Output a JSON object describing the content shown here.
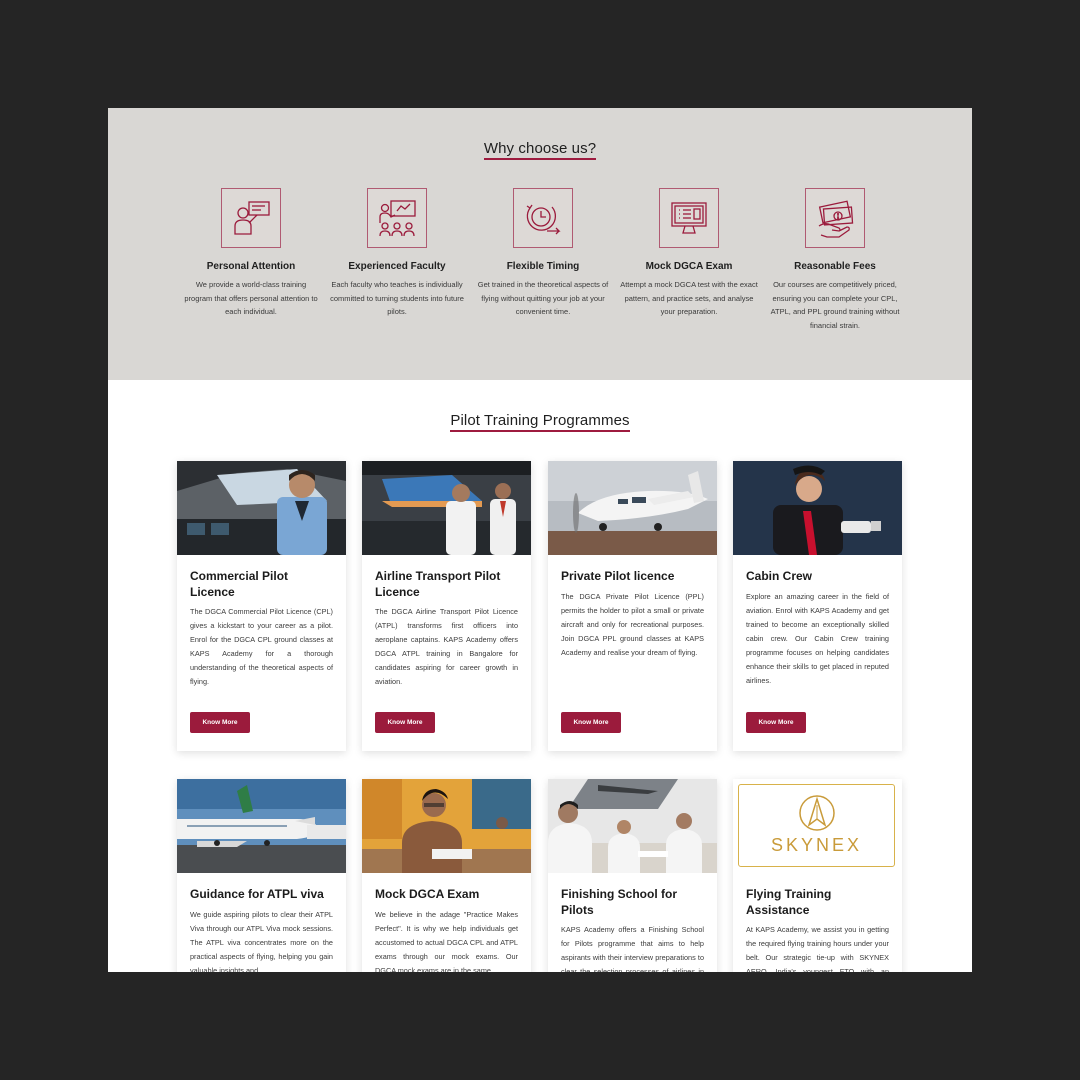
{
  "why": {
    "title": "Why choose us?",
    "features": [
      {
        "icon": "instructor-board-icon",
        "title": "Personal Attention",
        "desc": "We provide a world-class training program that offers personal attention to each individual."
      },
      {
        "icon": "classroom-teacher-icon",
        "title": "Experienced Faculty",
        "desc": "Each faculty who teaches is individually committed to turning students into future pilots."
      },
      {
        "icon": "clock-arrow-icon",
        "title": "Flexible Timing",
        "desc": "Get trained in the theoretical aspects of flying without quitting your job at your convenient time."
      },
      {
        "icon": "monitor-test-icon",
        "title": "Mock DGCA Exam",
        "desc": "Attempt a mock DGCA test with the exact pattern, and practice sets, and analyse your preparation."
      },
      {
        "icon": "money-hand-icon",
        "title": "Reasonable Fees",
        "desc": "Our courses are competitively priced, ensuring you can complete your CPL, ATPL, and PPL ground training without financial strain."
      }
    ]
  },
  "programmes": {
    "title": "Pilot Training Programmes",
    "button_label": "Know More",
    "cards": [
      {
        "title": "Commercial Pilot Licence",
        "desc": "The DGCA Commercial Pilot Licence (CPL) gives a kickstart to your career as a pilot. Enrol for the DGCA CPL ground classes at KAPS Academy for a thorough understanding of the theoretical aspects of flying.",
        "image": "pilot-in-cockpit"
      },
      {
        "title": "Airline Transport Pilot Licence",
        "desc": "The DGCA Airline Transport Pilot Licence (ATPL) transforms first officers into aeroplane captains. KAPS Academy offers DGCA ATPL training in Bangalore for candidates aspiring for career growth in aviation.",
        "image": "two-pilots-cockpit"
      },
      {
        "title": "Private Pilot licence",
        "desc": "The DGCA Private Pilot Licence (PPL) permits the holder to pilot a small or private aircraft and only for recreational purposes. Join DGCA PPL ground classes at KAPS Academy and realise your dream of flying.",
        "image": "small-aircraft"
      },
      {
        "title": "Cabin Crew",
        "desc": "Explore an amazing career in the field of aviation. Enrol with KAPS Academy and get trained to become an exceptionally skilled cabin crew. Our Cabin Crew training programme focuses on helping candidates enhance their skills to get placed in reputed airlines.",
        "image": "cabin-crew-member"
      },
      {
        "title": "Guidance for ATPL viva",
        "desc": "We guide aspiring pilots to clear their ATPL Viva through our ATPL Viva mock sessions. The ATPL viva concentrates more on the practical aspects of flying, helping you gain valuable insights and",
        "image": "airliners-on-tarmac"
      },
      {
        "title": "Mock DGCA Exam",
        "desc": "We believe in the adage \"Practice Makes Perfect\". It is why we help individuals get accustomed to actual DGCA CPL and ATPL exams through our mock exams. Our DGCA mock exams are in the same",
        "image": "student-writing-exam"
      },
      {
        "title": "Finishing School for Pilots",
        "desc": "KAPS Academy offers a Finishing School for Pilots programme that aims to help aspirants with their interview preparations to clear the selection processes of airlines in India and groom",
        "image": "pilots-in-classroom"
      },
      {
        "title": "Flying Training Assistance",
        "desc": "At KAPS Academy, we assist you in getting the required flying training hours under your belt. Our strategic tie-up with SKYNEX AERO, India's youngest FTO with an operational base in Jalgaon, helps us",
        "image": "skynex-logo",
        "logo_text": "SKYNEX"
      }
    ]
  },
  "colors": {
    "accent": "#9b1b3c",
    "band_bg": "#d9d7d4",
    "page_bg": "#252525"
  }
}
